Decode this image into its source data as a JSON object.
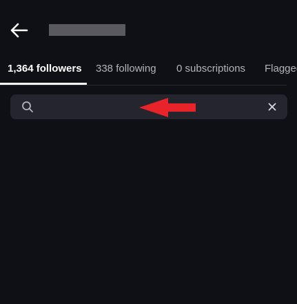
{
  "header": {
    "back_icon": "arrow-left-icon",
    "username": ""
  },
  "tabs": [
    {
      "label": "1,364 followers",
      "active": true
    },
    {
      "label": "338 following",
      "active": false
    },
    {
      "label": "0 subscriptions",
      "active": false
    },
    {
      "label": "Flagged",
      "active": false
    }
  ],
  "search": {
    "value": "",
    "placeholder": "",
    "search_icon": "search-icon",
    "clear_icon": "close-icon"
  },
  "colors": {
    "background": "#0f0f16",
    "search_field": "#25252d",
    "active_tab": "#ffffff",
    "inactive_tab": "#b4b4bb",
    "annotation_arrow": "#e8242a",
    "redaction": "#5a5a5e"
  }
}
